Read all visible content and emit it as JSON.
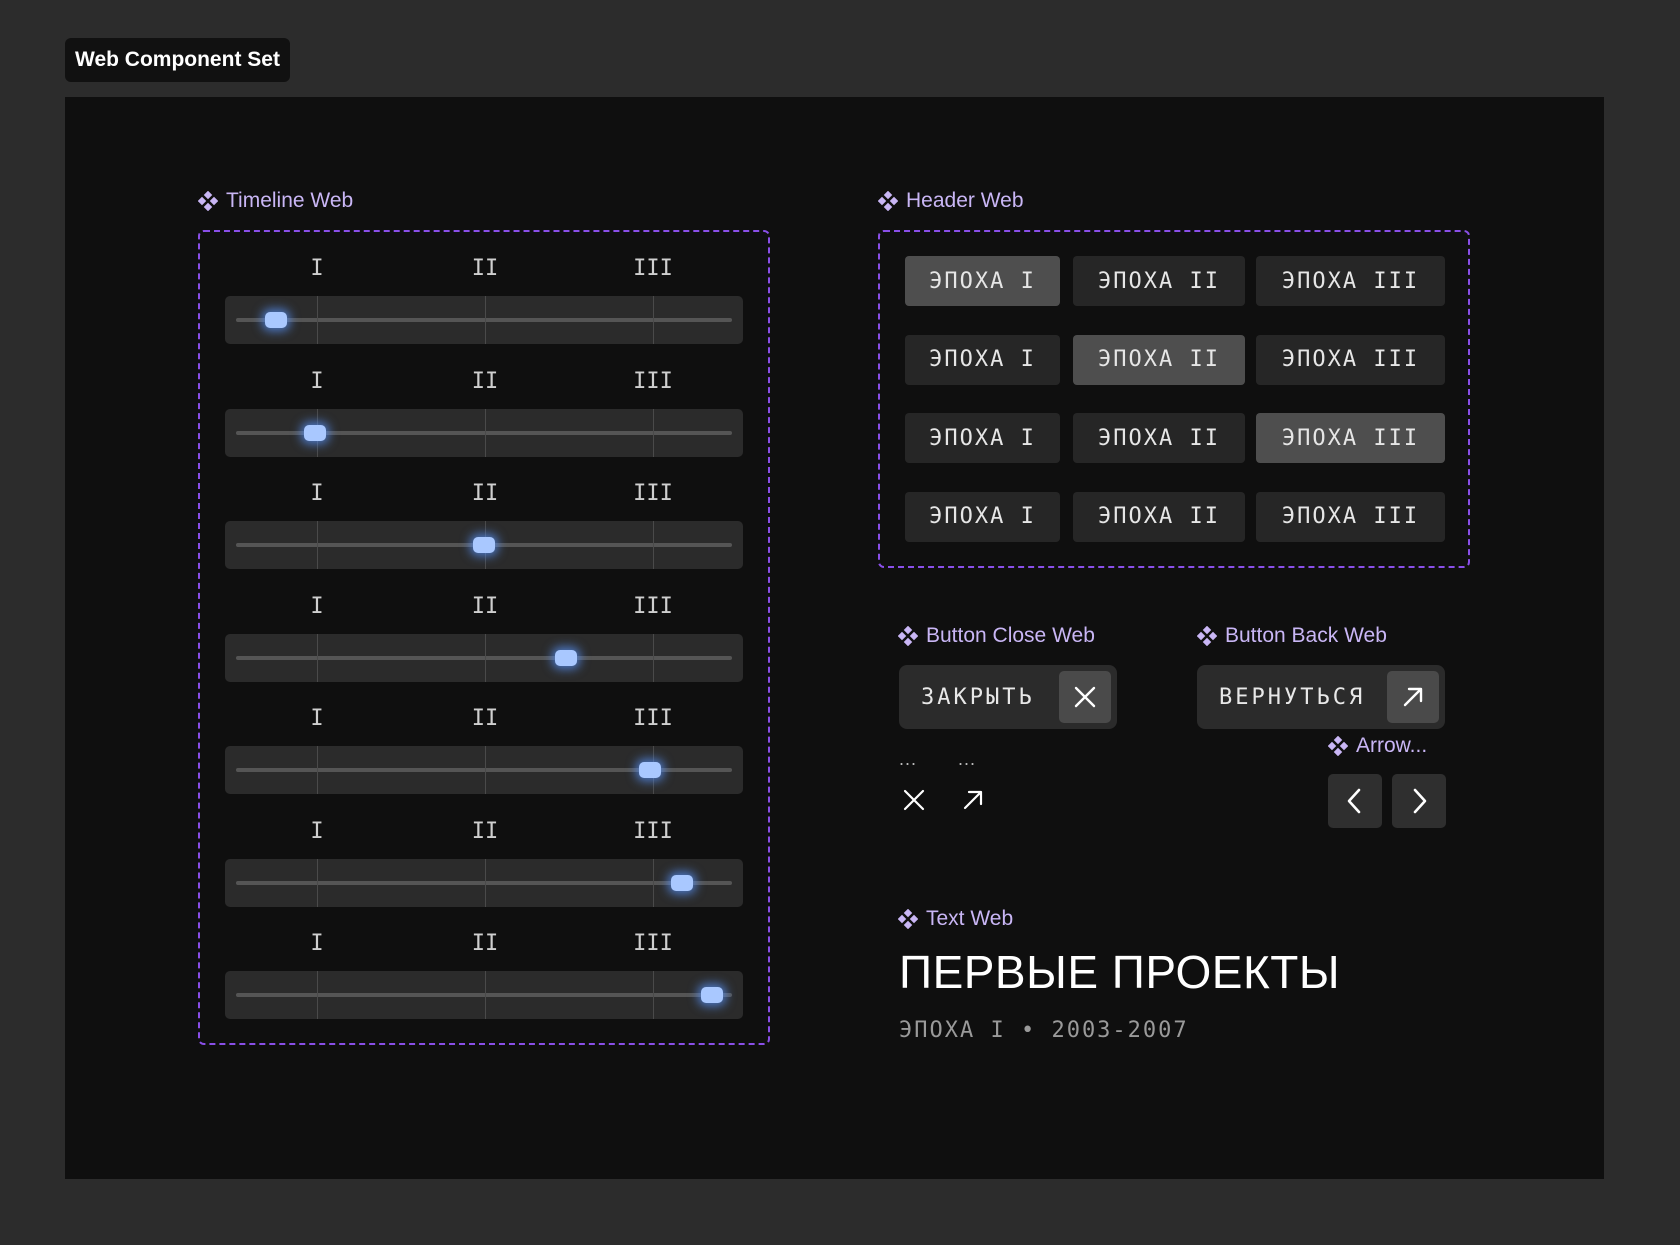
{
  "frame_title": "Web Component Set",
  "timeline": {
    "label": "Timeline Web",
    "epochs": [
      "I",
      "II",
      "III"
    ],
    "positions": [
      0.08,
      0.16,
      0.5,
      0.665,
      0.835,
      0.9,
      0.96
    ]
  },
  "header": {
    "label": "Header Web",
    "rows": [
      {
        "buttons": [
          "ЭПОХА I",
          "ЭПОХА II",
          "ЭПОХА III"
        ],
        "active": 0
      },
      {
        "buttons": [
          "ЭПОХА I",
          "ЭПОХА II",
          "ЭПОХА III"
        ],
        "active": 1
      },
      {
        "buttons": [
          "ЭПОХА I",
          "ЭПОХА II",
          "ЭПОХА III"
        ],
        "active": 2
      },
      {
        "buttons": [
          "ЭПОХА I",
          "ЭПОХА II",
          "ЭПОХА III"
        ],
        "active": -1
      }
    ]
  },
  "button_close": {
    "label": "Button Close Web",
    "text": "ЗАКРЫТЬ",
    "icon": "close-icon"
  },
  "button_back": {
    "label": "Button Back Web",
    "text": "ВЕРНУТЬСЯ",
    "icon": "arrow-up-right-icon"
  },
  "loose_icons": {
    "dots_1": "...",
    "dots_2": "...",
    "icon_1": "close-icon",
    "icon_2": "arrow-up-right-icon"
  },
  "arrow": {
    "label": "Arrow...",
    "left_icon": "chevron-left-icon",
    "right_icon": "chevron-right-icon"
  },
  "text_web": {
    "label": "Text Web",
    "title": "ПЕРВЫЕ ПРОЕКТЫ",
    "subtitle": "ЭПОХА I • 2003-2007"
  },
  "colors": {
    "accent": "#8a4fe8",
    "label": "#c9b6f5",
    "thumb": "#a9c8ff",
    "active": "#4e4e4e",
    "button": "#262626"
  }
}
